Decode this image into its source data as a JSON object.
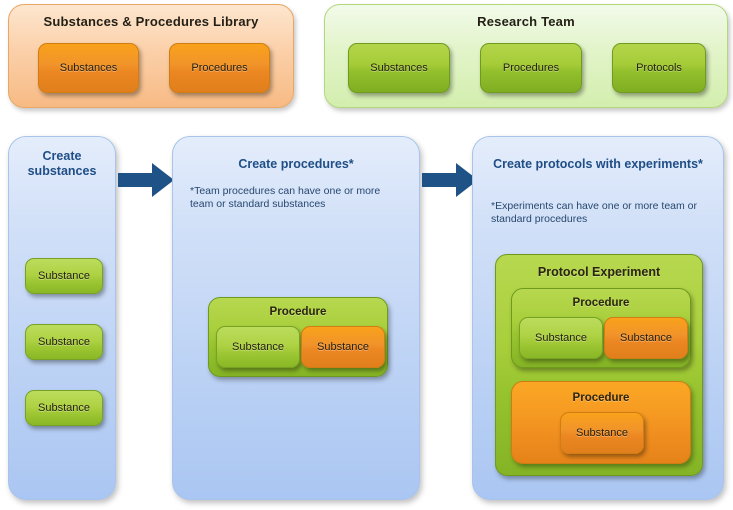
{
  "library": {
    "title": "Substances & Procedures Library",
    "accent": "#f1942a",
    "chips": [
      {
        "label": "Substances"
      },
      {
        "label": "Procedures"
      }
    ]
  },
  "team": {
    "title": "Research Team",
    "accent": "#a6cc38",
    "chips": [
      {
        "label": "Substances"
      },
      {
        "label": "Procedures"
      },
      {
        "label": "Protocols"
      }
    ]
  },
  "flow": {
    "arrow_color": "#1f5287",
    "panel_color": "#b9d0f4",
    "steps": [
      {
        "title": "Create substances",
        "note": "",
        "items": [
          {
            "label": "Substance"
          },
          {
            "label": "Substance"
          },
          {
            "label": "Substance"
          }
        ]
      },
      {
        "title": "Create procedures*",
        "note": "*Team procedures can have one or more team or standard substances",
        "procedure": {
          "title": "Procedure",
          "substances": [
            {
              "label": "Substance",
              "kind": "green"
            },
            {
              "label": "Substance",
              "kind": "orange"
            }
          ]
        }
      },
      {
        "title": "Create protocols with experiments*",
        "note": "*Experiments can have one or more team or standard procedures",
        "experiment": {
          "title": "Protocol Experiment",
          "procedures": [
            {
              "title": "Procedure",
              "kind": "green",
              "substances": [
                {
                  "label": "Substance",
                  "kind": "green"
                },
                {
                  "label": "Substance",
                  "kind": "orange"
                }
              ]
            },
            {
              "title": "Procedure",
              "kind": "orange",
              "substances": [
                {
                  "label": "Substance",
                  "kind": "orange"
                }
              ]
            }
          ]
        }
      }
    ]
  }
}
